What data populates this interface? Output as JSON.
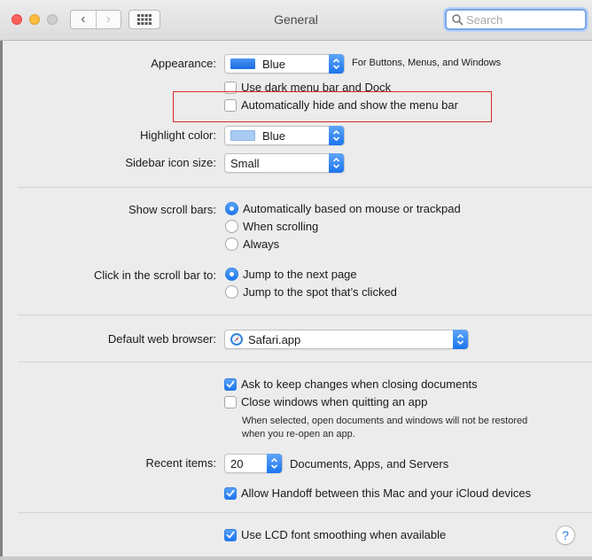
{
  "window": {
    "title": "General"
  },
  "toolbar": {
    "back_glyph": "‹",
    "forward_glyph": "›",
    "search_placeholder": "Search"
  },
  "appearance": {
    "label": "Appearance:",
    "value": "Blue",
    "swatch_color": "#1a73e8",
    "note": "For Buttons, Menus, and Windows",
    "dark_menu": {
      "label": "Use dark menu bar and Dock",
      "checked": false
    },
    "auto_hide": {
      "label": "Automatically hide and show the menu bar",
      "checked": false
    }
  },
  "highlight": {
    "label": "Highlight color:",
    "value": "Blue",
    "swatch_color": "#a9cbf2"
  },
  "sidebar_icon": {
    "label": "Sidebar icon size:",
    "value": "Small"
  },
  "scroll_bars": {
    "label": "Show scroll bars:",
    "options": [
      "Automatically based on mouse or trackpad",
      "When scrolling",
      "Always"
    ],
    "selected": 0
  },
  "click_scroll": {
    "label": "Click in the scroll bar to:",
    "options": [
      "Jump to the next page",
      "Jump to the spot that’s clicked"
    ],
    "selected": 0
  },
  "browser": {
    "label": "Default web browser:",
    "value": "Safari.app"
  },
  "documents": {
    "ask_keep": {
      "label": "Ask to keep changes when closing documents",
      "checked": true
    },
    "close_windows": {
      "label": "Close windows when quitting an app",
      "checked": false
    },
    "note_line1": "When selected, open documents and windows will not be restored",
    "note_line2": "when you re-open an app."
  },
  "recent": {
    "label": "Recent items:",
    "value": "20",
    "suffix": "Documents, Apps, and Servers"
  },
  "handoff": {
    "label": "Allow Handoff between this Mac and your iCloud devices",
    "checked": true
  },
  "lcd": {
    "label": "Use LCD font smoothing when available",
    "checked": true
  },
  "help": {
    "glyph": "?"
  },
  "colors": {
    "accent": "#1c75f0",
    "annotation": "#d9292b"
  }
}
